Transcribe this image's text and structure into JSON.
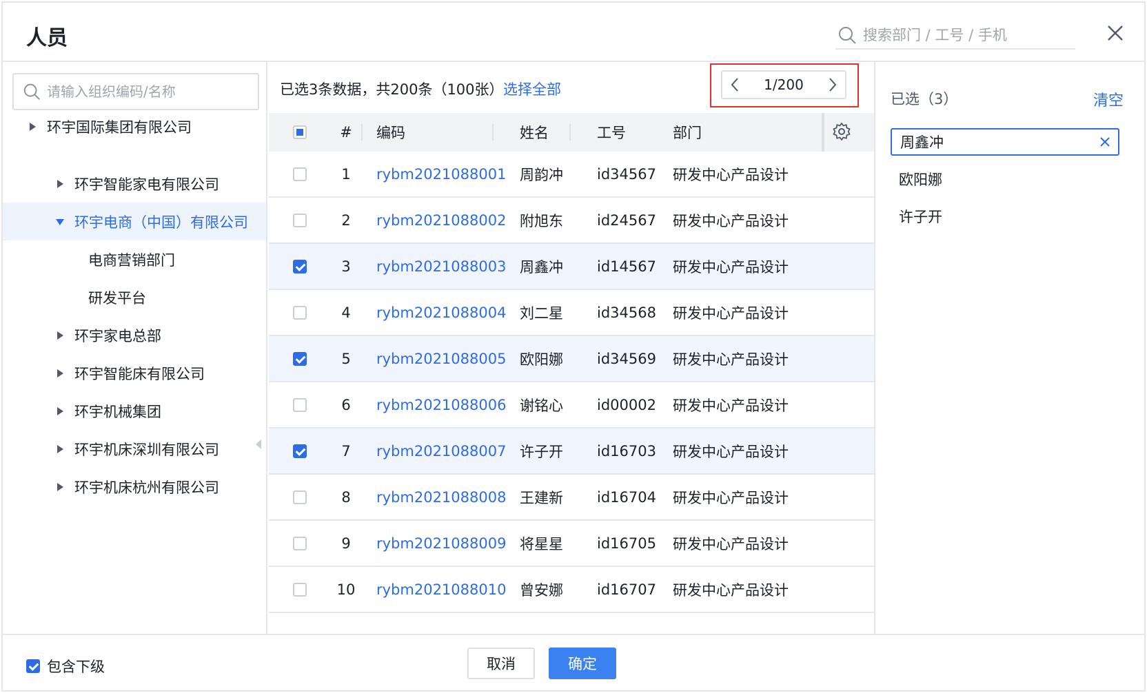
{
  "header": {
    "title": "人员",
    "search_placeholder": "搜索部门 / 工号 / 手机"
  },
  "left": {
    "search_placeholder": "请输入组织编码/名称",
    "tree": [
      {
        "label": "环宇国际集团有限公司",
        "level": 0,
        "expanded": false
      },
      {
        "label": "环宇智能家电有限公司",
        "level": 1,
        "expanded": false
      },
      {
        "label": "环宇电商（中国）有限公司",
        "level": 1,
        "expanded": true,
        "active": true
      },
      {
        "label": "电商营销部门",
        "level": 2
      },
      {
        "label": "研发平台",
        "level": 2
      },
      {
        "label": "环宇家电总部",
        "level": 1,
        "expanded": false
      },
      {
        "label": "环宇智能床有限公司",
        "level": 1,
        "expanded": false
      },
      {
        "label": "环宇机械集团",
        "level": 1,
        "expanded": false
      },
      {
        "label": "环宇机床深圳有限公司",
        "level": 1,
        "expanded": false
      },
      {
        "label": "环宇机床杭州有限公司",
        "level": 1,
        "expanded": false
      }
    ]
  },
  "middle": {
    "summary": "已选3条数据，共200条（100张）",
    "select_all": "选择全部",
    "pager": {
      "text": "1/200"
    },
    "columns": [
      "#",
      "编码",
      "姓名",
      "工号",
      "部门"
    ],
    "rows": [
      {
        "num": "1",
        "code": "rybm2021088001",
        "name": "周韵冲",
        "id": "id34567",
        "dept": "研发中心产品设计",
        "checked": false
      },
      {
        "num": "2",
        "code": "rybm2021088002",
        "name": "附旭东",
        "id": "id24567",
        "dept": "研发中心产品设计",
        "checked": false
      },
      {
        "num": "3",
        "code": "rybm2021088003",
        "name": "周鑫冲",
        "id": "id14567",
        "dept": "研发中心产品设计",
        "checked": true
      },
      {
        "num": "4",
        "code": "rybm2021088004",
        "name": "刘二星",
        "id": "id34568",
        "dept": "研发中心产品设计",
        "checked": false
      },
      {
        "num": "5",
        "code": "rybm2021088005",
        "name": "欧阳娜",
        "id": "id34569",
        "dept": "研发中心产品设计",
        "checked": true
      },
      {
        "num": "6",
        "code": "rybm2021088006",
        "name": "谢铭心",
        "id": "id00002",
        "dept": "研发中心产品设计",
        "checked": false
      },
      {
        "num": "7",
        "code": "rybm2021088007",
        "name": "许子开",
        "id": "id16703",
        "dept": "研发中心产品设计",
        "checked": true
      },
      {
        "num": "8",
        "code": "rybm2021088008",
        "name": "王建新",
        "id": "id16704",
        "dept": "研发中心产品设计",
        "checked": false
      },
      {
        "num": "9",
        "code": "rybm2021088009",
        "name": "将星星",
        "id": "id16705",
        "dept": "研发中心产品设计",
        "checked": false
      },
      {
        "num": "10",
        "code": "rybm2021088010",
        "name": "曾安娜",
        "id": "id16707",
        "dept": "研发中心产品设计",
        "checked": false
      }
    ]
  },
  "right": {
    "selected_title": "已选（3）",
    "clear": "清空",
    "items": [
      {
        "label": "周鑫冲",
        "focused": true
      },
      {
        "label": "欧阳娜",
        "focused": false
      },
      {
        "label": "许子开",
        "focused": false
      }
    ]
  },
  "footer": {
    "include_sub": "包含下级",
    "include_sub_checked": true,
    "cancel": "取消",
    "ok": "确定"
  },
  "colors": {
    "accent": "#2e6be6",
    "primary_button": "#3b82f0",
    "highlight_border": "#e03030",
    "selected_row": "#f0f5ff"
  },
  "icons": {
    "search": "search-icon",
    "close": "close-icon",
    "gear": "gear-icon",
    "caret_right": "caret-right-icon",
    "caret_down": "caret-down-icon",
    "chevron_left": "chevron-left-icon",
    "chevron_right": "chevron-right-icon"
  }
}
